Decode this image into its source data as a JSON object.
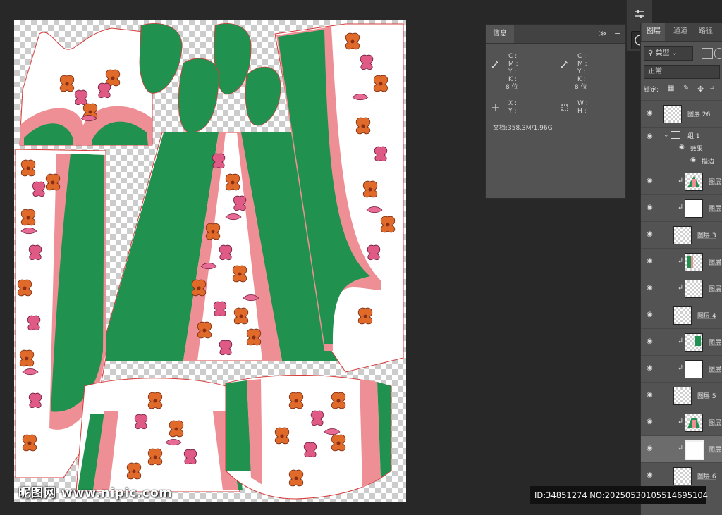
{
  "canvas": {
    "watermark": "昵图网 www.nipic.com"
  },
  "mini_toolbar": {
    "items": [
      "adjust-icon",
      "info-icon"
    ]
  },
  "info_panel": {
    "tab": "信息",
    "expand": "≫",
    "menu": "≡",
    "cmyk_labels": [
      "C :",
      "M :",
      "Y :",
      "K :"
    ],
    "bit_depth": "8 位",
    "xy_labels": [
      "X :",
      "Y :"
    ],
    "wh_labels": [
      "W :",
      "H :"
    ],
    "doc_size": "文档:358.3M/1.96G"
  },
  "layers_panel": {
    "tabs": [
      "图层",
      "通道",
      "路径"
    ],
    "filter_kind": "类型",
    "blend_mode": "正常",
    "lock_label": "锁定:",
    "layers": [
      {
        "name": "图层 26"
      },
      {
        "name": "组 1"
      },
      {
        "name": "效果"
      },
      {
        "name": "描边"
      },
      {
        "name": "图层"
      },
      {
        "name": "图层"
      },
      {
        "name": "图层 3"
      },
      {
        "name": "图层"
      },
      {
        "name": "图层"
      },
      {
        "name": "图层 4"
      },
      {
        "name": "图层"
      },
      {
        "name": "图层"
      },
      {
        "name": "图层 5"
      },
      {
        "name": "图层"
      },
      {
        "name": "图层"
      },
      {
        "name": "图层 6"
      }
    ]
  },
  "id_strip": "ID:34851274 NO:20250530105514695104",
  "colors": {
    "green": "#21914f",
    "pink": "#ee8f95",
    "orange": "#e06a2a",
    "magenta": "#e05a86",
    "outline": "#d83a3a"
  }
}
